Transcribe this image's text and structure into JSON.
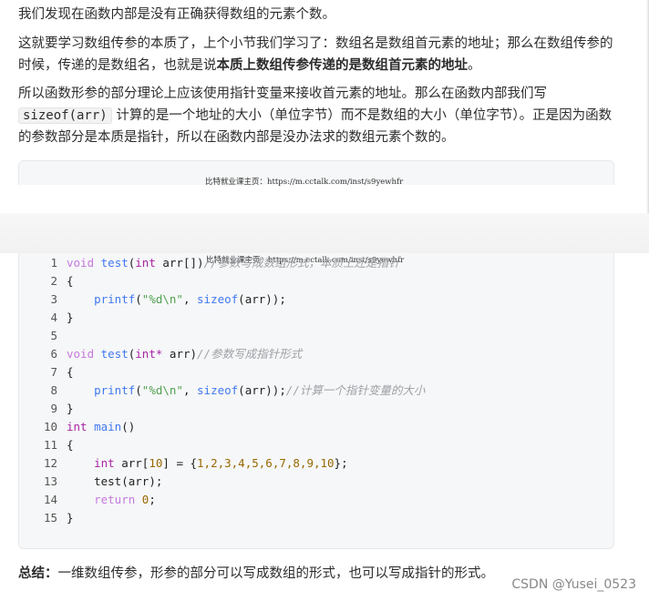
{
  "paragraphs": {
    "p1": "我们发现在函数内部是没有正确获得数组的元素个数。",
    "p2_a": "这就要学习数组传参的本质了，上个小节我们学习了：数组名是数组首元素的地址；那么在数组传参的时候，传递的是数组名，也就是说",
    "p2_b": "本质上数组传参传递的是数组首元素的地址",
    "p2_c": "。",
    "p3_a": "所以函数形参的部分理论上应该使用指针变量来接收首元素的地址。那么在函数内部我们写",
    "p3_code": "sizeof(arr)",
    "p3_b": "计算的是一个地址的大小（单位字节）而不是数组的大小（单位字节）。正是因为函数的参数部分是本质是指针，所以在函数内部是没办法求的数组元素个数的。"
  },
  "watermark": "比特就业课主页：https://m.cctalk.com/inst/s9yewhfr",
  "code": {
    "line_numbers": [
      "1",
      "2",
      "3",
      "4",
      "5",
      "6",
      "7",
      "8",
      "9",
      "10",
      "11",
      "12",
      "13",
      "14",
      "15"
    ],
    "l1": {
      "kw": "void",
      "fn": "test",
      "a": "(",
      "typ": "int",
      "b": " arr[])",
      "cm": "//参数写成数组形式，本质上还是指针"
    },
    "l2": "{",
    "l3": {
      "fn": "printf",
      "a": "(",
      "str": "\"%d\\n\"",
      "b": ", ",
      "fn2": "sizeof",
      "c": "(arr));"
    },
    "l4": "}",
    "l5": "",
    "l6": {
      "kw": "void",
      "fn": "test",
      "a": "(",
      "typ": "int*",
      "b": " arr)",
      "cm": "//参数写成指针形式"
    },
    "l7": "{",
    "l8": {
      "fn": "printf",
      "a": "(",
      "str": "\"%d\\n\"",
      "b": ", ",
      "fn2": "sizeof",
      "c": "(arr));",
      "cm": "//计算一个指针变量的大小"
    },
    "l9": "}",
    "l10": {
      "typ": "int",
      "fn": "main",
      "a": "()"
    },
    "l11": "{",
    "l12": {
      "typ": "int",
      "a": " arr[",
      "n": "10",
      "b": "] = {",
      "nums": "1,2,3,4,5,6,7,8,9,10",
      "c": "};"
    },
    "l13": "test(arr);",
    "l14": {
      "kw": "return",
      "n": "0",
      "a": ";"
    },
    "l15": "}"
  },
  "summary": {
    "label": "总结：",
    "text": "一维数组传参，形参的部分可以写成数组的形式，也可以写成指针的形式。"
  },
  "csdn": "CSDN @Yusei_0523"
}
